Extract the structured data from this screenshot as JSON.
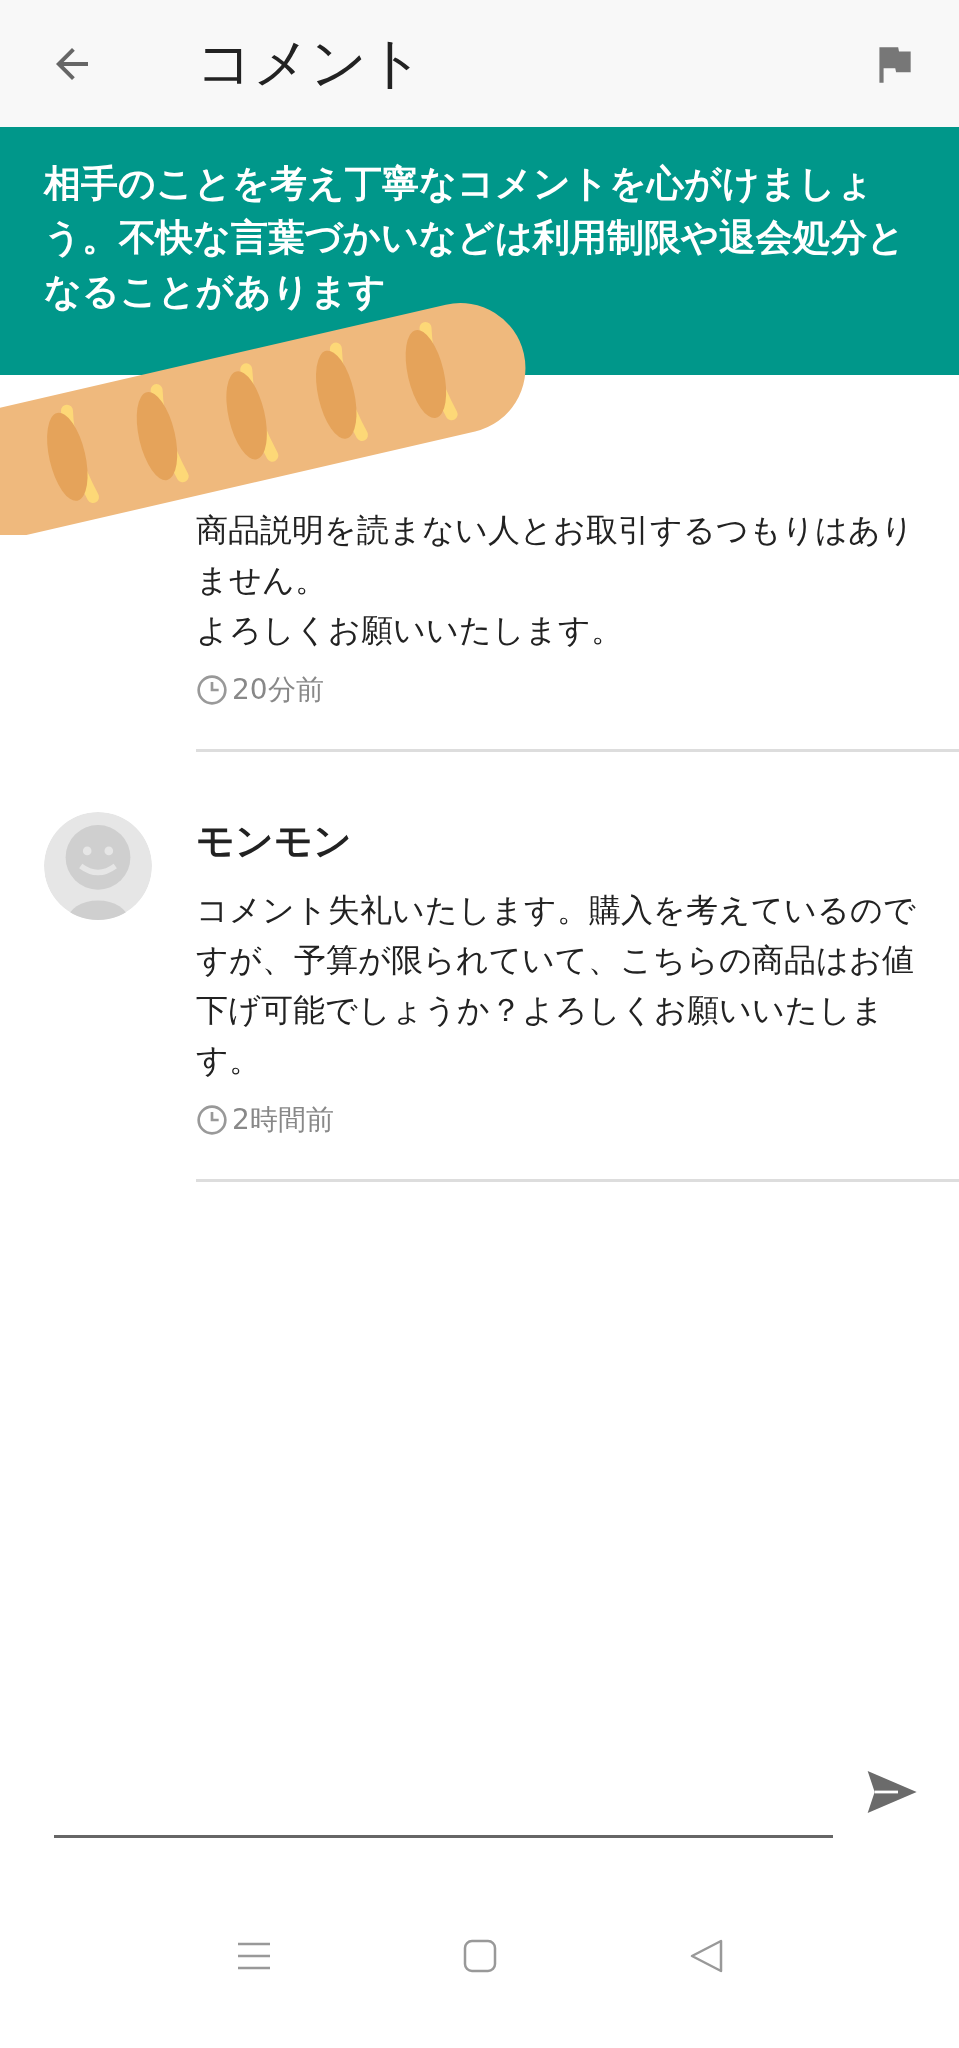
{
  "header": {
    "title": "コメント"
  },
  "notice": "相手のことを考え丁寧なコメントを心がけましょう。不快な言葉づかいなどは利用制限や退会処分となることがあります",
  "comments": [
    {
      "lines": [
        "商品説明を読まない人とお取引するつもりはありません。",
        "よろしくお願いいたします。"
      ],
      "time": "20分前"
    },
    {
      "name": "モンモン",
      "lines": [
        "コメント失礼いたします。購入を考えているのですが、予算が限られていて、こちらの商品はお値下げ可能でしょうか？よろしくお願いいたします。"
      ],
      "time": "2時間前"
    }
  ]
}
